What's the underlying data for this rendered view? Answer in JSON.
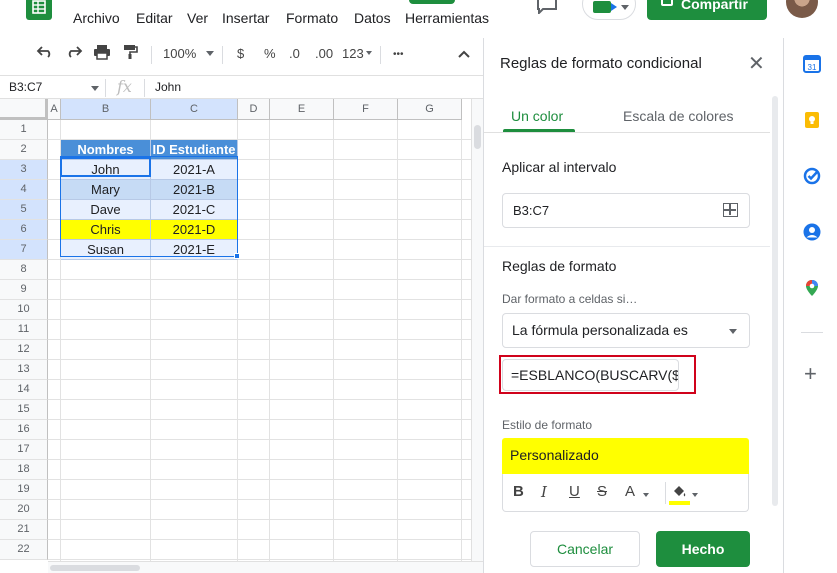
{
  "menu": [
    "Archivo",
    "Editar",
    "Ver",
    "Insertar",
    "Formato",
    "Datos",
    "Herramientas"
  ],
  "header": {
    "share_label": "Compartir"
  },
  "toolbar": {
    "zoom": "100%",
    "currency": "$",
    "percent": "%",
    "dec_less": ".0",
    "dec_more": ".00",
    "number_format": "123",
    "more": "•••"
  },
  "formula_bar": {
    "name_box": "B3:C7",
    "fx": "fx",
    "value": "John"
  },
  "grid": {
    "columns": [
      "A",
      "B",
      "C",
      "D",
      "E",
      "F",
      "G"
    ],
    "rows": [
      "1",
      "2",
      "3",
      "4",
      "5",
      "6",
      "7",
      "8",
      "9",
      "10",
      "11",
      "12",
      "13",
      "14",
      "15",
      "16",
      "17",
      "18",
      "19",
      "20",
      "21",
      "22"
    ],
    "table_headers": [
      "Nombres",
      "ID Estudiante"
    ],
    "table_rows": [
      [
        "John",
        "2021-A"
      ],
      [
        "Mary",
        "2021-B"
      ],
      [
        "Dave",
        "2021-C"
      ],
      [
        "Chris",
        "2021-D"
      ],
      [
        "Susan",
        "2021-E"
      ]
    ]
  },
  "panel": {
    "title": "Reglas de formato condicional",
    "tab_single": "Un color",
    "tab_scale": "Escala de colores",
    "apply_range_label": "Aplicar al intervalo",
    "range_value": "B3:C7",
    "rules_label": "Reglas de formato",
    "condition_label": "Dar formato a celdas si…",
    "condition_value": "La fórmula personalizada es",
    "formula_value": "=ESBLANCO(BUSCARV($C",
    "style_label": "Estilo de formato",
    "style_value": "Personalizado",
    "style_tools": {
      "bold": "B",
      "italic": "I",
      "underline": "U",
      "strike": "S",
      "text_color": "A"
    },
    "cancel_label": "Cancelar",
    "done_label": "Hecho"
  },
  "colors": {
    "accent_green": "#1e8e3e",
    "header_blue": "#4a8fd8",
    "band_light": "#e8f0fe",
    "band_mid": "#c6dbf5",
    "highlight_yellow": "#ffff00",
    "callout_red": "#d0021b"
  }
}
